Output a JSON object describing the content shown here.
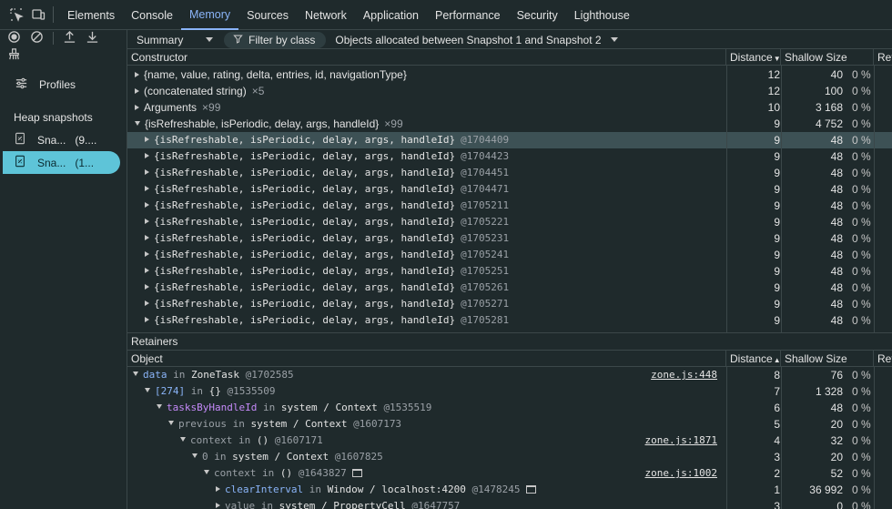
{
  "tabs": [
    {
      "label": "Elements",
      "active": false
    },
    {
      "label": "Console",
      "active": false
    },
    {
      "label": "Memory",
      "active": true
    },
    {
      "label": "Sources",
      "active": false
    },
    {
      "label": "Network",
      "active": false
    },
    {
      "label": "Application",
      "active": false
    },
    {
      "label": "Performance",
      "active": false
    },
    {
      "label": "Security",
      "active": false
    },
    {
      "label": "Lighthouse",
      "active": false
    }
  ],
  "sidebar": {
    "profiles_label": "Profiles",
    "heap_title": "Heap snapshots",
    "snapshots": [
      {
        "label": "Sna...",
        "size": "(9....",
        "selected": false
      },
      {
        "label": "Sna...",
        "size": "(1...",
        "selected": true
      }
    ]
  },
  "toolbar": {
    "view": "Summary",
    "filter": "Filter by class",
    "scope": "Objects allocated between Snapshot 1 and Snapshot 2"
  },
  "constructors": {
    "headers": {
      "constructor": "Constructor",
      "distance": "Distance",
      "shallow": "Shallow Size",
      "retained": "Ret"
    },
    "rows": [
      {
        "name": "{name, value, rating, delta, entries, id, navigationType}",
        "count": "",
        "id": "",
        "distance": "12",
        "shallow": "40",
        "pct": "0 %",
        "level": 0,
        "expanded": false,
        "mono": false
      },
      {
        "name": "(concatenated string)",
        "count": "×5",
        "id": "",
        "distance": "12",
        "shallow": "100",
        "pct": "0 %",
        "level": 0,
        "expanded": false,
        "mono": false
      },
      {
        "name": "Arguments",
        "count": "×99",
        "id": "",
        "distance": "10",
        "shallow": "3 168",
        "pct": "0 %",
        "level": 0,
        "expanded": false,
        "mono": false
      },
      {
        "name": "{isRefreshable, isPeriodic, delay, args, handleId}",
        "count": "×99",
        "id": "",
        "distance": "9",
        "shallow": "4 752",
        "pct": "0 %",
        "level": 0,
        "expanded": true,
        "mono": false
      },
      {
        "name": "{isRefreshable, isPeriodic, delay, args, handleId}",
        "count": "",
        "id": "@1704409",
        "distance": "9",
        "shallow": "48",
        "pct": "0 %",
        "level": 1,
        "expanded": false,
        "mono": true,
        "selected": true
      },
      {
        "name": "{isRefreshable, isPeriodic, delay, args, handleId}",
        "count": "",
        "id": "@1704423",
        "distance": "9",
        "shallow": "48",
        "pct": "0 %",
        "level": 1,
        "expanded": false,
        "mono": true
      },
      {
        "name": "{isRefreshable, isPeriodic, delay, args, handleId}",
        "count": "",
        "id": "@1704451",
        "distance": "9",
        "shallow": "48",
        "pct": "0 %",
        "level": 1,
        "expanded": false,
        "mono": true
      },
      {
        "name": "{isRefreshable, isPeriodic, delay, args, handleId}",
        "count": "",
        "id": "@1704471",
        "distance": "9",
        "shallow": "48",
        "pct": "0 %",
        "level": 1,
        "expanded": false,
        "mono": true
      },
      {
        "name": "{isRefreshable, isPeriodic, delay, args, handleId}",
        "count": "",
        "id": "@1705211",
        "distance": "9",
        "shallow": "48",
        "pct": "0 %",
        "level": 1,
        "expanded": false,
        "mono": true
      },
      {
        "name": "{isRefreshable, isPeriodic, delay, args, handleId}",
        "count": "",
        "id": "@1705221",
        "distance": "9",
        "shallow": "48",
        "pct": "0 %",
        "level": 1,
        "expanded": false,
        "mono": true
      },
      {
        "name": "{isRefreshable, isPeriodic, delay, args, handleId}",
        "count": "",
        "id": "@1705231",
        "distance": "9",
        "shallow": "48",
        "pct": "0 %",
        "level": 1,
        "expanded": false,
        "mono": true
      },
      {
        "name": "{isRefreshable, isPeriodic, delay, args, handleId}",
        "count": "",
        "id": "@1705241",
        "distance": "9",
        "shallow": "48",
        "pct": "0 %",
        "level": 1,
        "expanded": false,
        "mono": true
      },
      {
        "name": "{isRefreshable, isPeriodic, delay, args, handleId}",
        "count": "",
        "id": "@1705251",
        "distance": "9",
        "shallow": "48",
        "pct": "0 %",
        "level": 1,
        "expanded": false,
        "mono": true
      },
      {
        "name": "{isRefreshable, isPeriodic, delay, args, handleId}",
        "count": "",
        "id": "@1705261",
        "distance": "9",
        "shallow": "48",
        "pct": "0 %",
        "level": 1,
        "expanded": false,
        "mono": true
      },
      {
        "name": "{isRefreshable, isPeriodic, delay, args, handleId}",
        "count": "",
        "id": "@1705271",
        "distance": "9",
        "shallow": "48",
        "pct": "0 %",
        "level": 1,
        "expanded": false,
        "mono": true
      },
      {
        "name": "{isRefreshable, isPeriodic, delay, args, handleId}",
        "count": "",
        "id": "@1705281",
        "distance": "9",
        "shallow": "48",
        "pct": "0 %",
        "level": 1,
        "expanded": false,
        "mono": true
      }
    ]
  },
  "retainers": {
    "title": "Retainers",
    "headers": {
      "object": "Object",
      "distance": "Distance",
      "shallow": "Shallow Size",
      "retained": "Ret"
    },
    "rows": [
      {
        "prop": "data",
        "propStyle": "blue",
        "in": "in",
        "target": "ZoneTask",
        "id": "@1702585",
        "link": "zone.js:448",
        "distance": "8",
        "shallow": "76",
        "pct": "0 %",
        "level": 0,
        "window": false
      },
      {
        "prop": "[274]",
        "propStyle": "blue",
        "in": "in",
        "target": "{}",
        "id": "@1535509",
        "link": "",
        "distance": "7",
        "shallow": "1 328",
        "pct": "0 %",
        "level": 1,
        "window": false
      },
      {
        "prop": "tasksByHandleId",
        "propStyle": "purple",
        "in": "in",
        "target": "system / Context",
        "id": "@1535519",
        "link": "",
        "distance": "6",
        "shallow": "48",
        "pct": "0 %",
        "level": 2,
        "window": false
      },
      {
        "prop": "previous",
        "propStyle": "dim",
        "in": "in",
        "target": "system / Context",
        "id": "@1607173",
        "link": "",
        "distance": "5",
        "shallow": "20",
        "pct": "0 %",
        "level": 3,
        "window": false
      },
      {
        "prop": "context",
        "propStyle": "dim",
        "in": "in",
        "target": "()",
        "id": "@1607171",
        "link": "zone.js:1871",
        "distance": "4",
        "shallow": "32",
        "pct": "0 %",
        "level": 4,
        "window": false
      },
      {
        "prop": "0",
        "propStyle": "dim",
        "in": "in",
        "target": "system / Context",
        "id": "@1607825",
        "link": "",
        "distance": "3",
        "shallow": "20",
        "pct": "0 %",
        "level": 5,
        "window": false
      },
      {
        "prop": "context",
        "propStyle": "dim",
        "in": "in",
        "target": "()",
        "id": "@1643827",
        "link": "zone.js:1002",
        "distance": "2",
        "shallow": "52",
        "pct": "0 %",
        "level": 6,
        "window": true
      },
      {
        "prop": "clearInterval",
        "propStyle": "blue",
        "in": "in",
        "target": "Window / localhost:4200",
        "id": "@1478245",
        "link": "",
        "distance": "1",
        "shallow": "36 992",
        "pct": "0 %",
        "level": 7,
        "window": true,
        "collapsed": true
      },
      {
        "prop": "value",
        "propStyle": "dim",
        "in": "in",
        "target": "system / PropertyCell",
        "id": "@1647757",
        "link": "",
        "distance": "3",
        "shallow": "0",
        "pct": "0 %",
        "level": 7,
        "window": false,
        "collapsed": true
      }
    ]
  }
}
